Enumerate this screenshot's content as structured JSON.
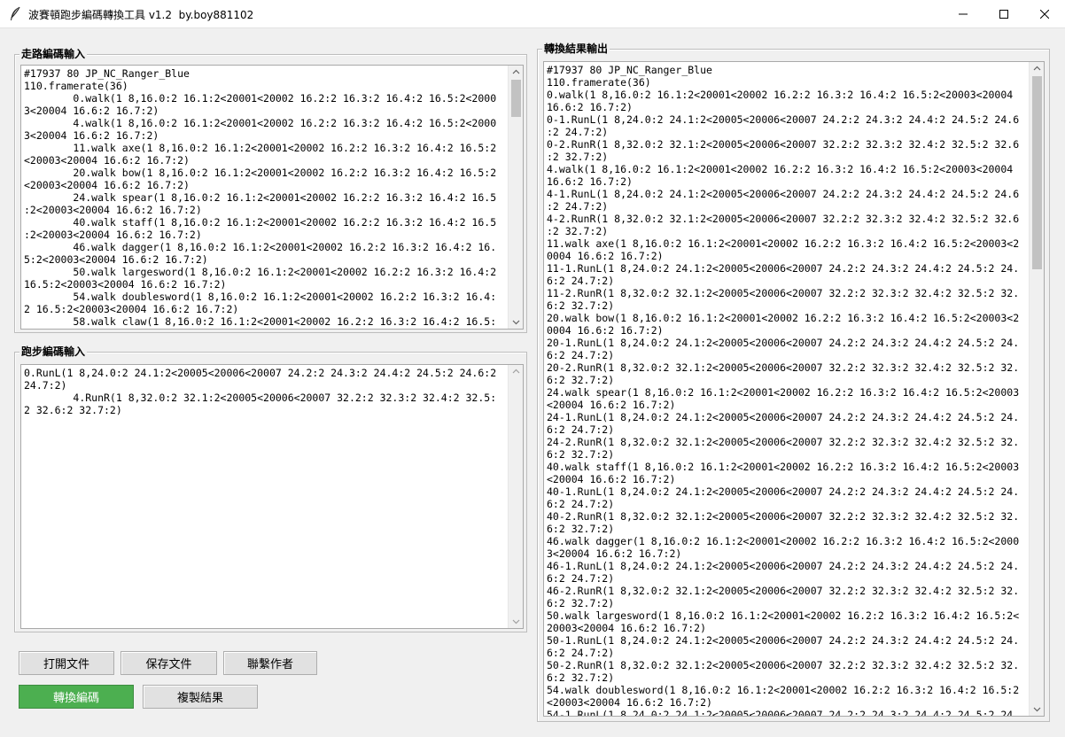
{
  "window": {
    "title": "波賽頓跑步編碼轉換工具 v1.2  by.boy881102"
  },
  "icons": {
    "app": "feather-icon",
    "minimize": "minimize-icon",
    "maximize": "maximize-icon",
    "close": "close-icon",
    "scroll_up": "chevron-up-icon",
    "scroll_down": "chevron-down-icon"
  },
  "colors": {
    "accent_button": "#4caf50",
    "background": "#f0f0f0"
  },
  "walk_input": {
    "label": "走路編碼輸入",
    "text": "#17937 80 JP_NC_Ranger_Blue\n110.framerate(36)\n\t0.walk(1 8,16.0:2 16.1:2<20001<20002 16.2:2 16.3:2 16.4:2 16.5:2<2000\n3<20004 16.6:2 16.7:2)\n\t4.walk(1 8,16.0:2 16.1:2<20001<20002 16.2:2 16.3:2 16.4:2 16.5:2<2000\n3<20004 16.6:2 16.7:2)\n\t11.walk axe(1 8,16.0:2 16.1:2<20001<20002 16.2:2 16.3:2 16.4:2 16.5:2\n<20003<20004 16.6:2 16.7:2)\n\t20.walk bow(1 8,16.0:2 16.1:2<20001<20002 16.2:2 16.3:2 16.4:2 16.5:2\n<20003<20004 16.6:2 16.7:2)\n\t24.walk spear(1 8,16.0:2 16.1:2<20001<20002 16.2:2 16.3:2 16.4:2 16.5\n:2<20003<20004 16.6:2 16.7:2)\n\t40.walk staff(1 8,16.0:2 16.1:2<20001<20002 16.2:2 16.3:2 16.4:2 16.5\n:2<20003<20004 16.6:2 16.7:2)\n\t46.walk dagger(1 8,16.0:2 16.1:2<20001<20002 16.2:2 16.3:2 16.4:2 16.\n5:2<20003<20004 16.6:2 16.7:2)\n\t50.walk largesword(1 8,16.0:2 16.1:2<20001<20002 16.2:2 16.3:2 16.4:2\n16.5:2<20003<20004 16.6:2 16.7:2)\n\t54.walk doublesword(1 8,16.0:2 16.1:2<20001<20002 16.2:2 16.3:2 16.4:\n2 16.5:2<20003<20004 16.6:2 16.7:2)\n\t58.walk claw(1 8,16.0:2 16.1:2<20001<20002 16.2:2 16.3:2 16.4:2 16.5:"
  },
  "run_input": {
    "label": "跑步編碼輸入",
    "text": "0.RunL(1 8,24.0:2 24.1:2<20005<20006<20007 24.2:2 24.3:2 24.4:2 24.5:2 24.6:2\n24.7:2)\n\t4.RunR(1 8,32.0:2 32.1:2<20005<20006<20007 32.2:2 32.3:2 32.4:2 32.5:\n2 32.6:2 32.7:2)"
  },
  "output": {
    "label": "轉換結果輸出",
    "text": "#17937 80 JP_NC_Ranger_Blue\n110.framerate(36)\n0.walk(1 8,16.0:2 16.1:2<20001<20002 16.2:2 16.3:2 16.4:2 16.5:2<20003<20004\n16.6:2 16.7:2)\n0-1.RunL(1 8,24.0:2 24.1:2<20005<20006<20007 24.2:2 24.3:2 24.4:2 24.5:2 24.6\n:2 24.7:2)\n0-2.RunR(1 8,32.0:2 32.1:2<20005<20006<20007 32.2:2 32.3:2 32.4:2 32.5:2 32.6\n:2 32.7:2)\n4.walk(1 8,16.0:2 16.1:2<20001<20002 16.2:2 16.3:2 16.4:2 16.5:2<20003<20004\n16.6:2 16.7:2)\n4-1.RunL(1 8,24.0:2 24.1:2<20005<20006<20007 24.2:2 24.3:2 24.4:2 24.5:2 24.6\n:2 24.7:2)\n4-2.RunR(1 8,32.0:2 32.1:2<20005<20006<20007 32.2:2 32.3:2 32.4:2 32.5:2 32.6\n:2 32.7:2)\n11.walk axe(1 8,16.0:2 16.1:2<20001<20002 16.2:2 16.3:2 16.4:2 16.5:2<20003<2\n0004 16.6:2 16.7:2)\n11-1.RunL(1 8,24.0:2 24.1:2<20005<20006<20007 24.2:2 24.3:2 24.4:2 24.5:2 24.\n6:2 24.7:2)\n11-2.RunR(1 8,32.0:2 32.1:2<20005<20006<20007 32.2:2 32.3:2 32.4:2 32.5:2 32.\n6:2 32.7:2)\n20.walk bow(1 8,16.0:2 16.1:2<20001<20002 16.2:2 16.3:2 16.4:2 16.5:2<20003<2\n0004 16.6:2 16.7:2)\n20-1.RunL(1 8,24.0:2 24.1:2<20005<20006<20007 24.2:2 24.3:2 24.4:2 24.5:2 24.\n6:2 24.7:2)\n20-2.RunR(1 8,32.0:2 32.1:2<20005<20006<20007 32.2:2 32.3:2 32.4:2 32.5:2 32.\n6:2 32.7:2)\n24.walk spear(1 8,16.0:2 16.1:2<20001<20002 16.2:2 16.3:2 16.4:2 16.5:2<20003\n<20004 16.6:2 16.7:2)\n24-1.RunL(1 8,24.0:2 24.1:2<20005<20006<20007 24.2:2 24.3:2 24.4:2 24.5:2 24.\n6:2 24.7:2)\n24-2.RunR(1 8,32.0:2 32.1:2<20005<20006<20007 32.2:2 32.3:2 32.4:2 32.5:2 32.\n6:2 32.7:2)\n40.walk staff(1 8,16.0:2 16.1:2<20001<20002 16.2:2 16.3:2 16.4:2 16.5:2<20003\n<20004 16.6:2 16.7:2)\n40-1.RunL(1 8,24.0:2 24.1:2<20005<20006<20007 24.2:2 24.3:2 24.4:2 24.5:2 24.\n6:2 24.7:2)\n40-2.RunR(1 8,32.0:2 32.1:2<20005<20006<20007 32.2:2 32.3:2 32.4:2 32.5:2 32.\n6:2 32.7:2)\n46.walk dagger(1 8,16.0:2 16.1:2<20001<20002 16.2:2 16.3:2 16.4:2 16.5:2<2000\n3<20004 16.6:2 16.7:2)\n46-1.RunL(1 8,24.0:2 24.1:2<20005<20006<20007 24.2:2 24.3:2 24.4:2 24.5:2 24.\n6:2 24.7:2)\n46-2.RunR(1 8,32.0:2 32.1:2<20005<20006<20007 32.2:2 32.3:2 32.4:2 32.5:2 32.\n6:2 32.7:2)\n50.walk largesword(1 8,16.0:2 16.1:2<20001<20002 16.2:2 16.3:2 16.4:2 16.5:2<\n20003<20004 16.6:2 16.7:2)\n50-1.RunL(1 8,24.0:2 24.1:2<20005<20006<20007 24.2:2 24.3:2 24.4:2 24.5:2 24.\n6:2 24.7:2)\n50-2.RunR(1 8,32.0:2 32.1:2<20005<20006<20007 32.2:2 32.3:2 32.4:2 32.5:2 32.\n6:2 32.7:2)\n54.walk doublesword(1 8,16.0:2 16.1:2<20001<20002 16.2:2 16.3:2 16.4:2 16.5:2\n<20003<20004 16.6:2 16.7:2)\n54-1.RunL(1 8,24.0:2 24.1:2<20005<20006<20007 24.2:2 24.3:2 24.4:2 24.5:2 24."
  },
  "buttons": {
    "open_file": "打開文件",
    "save_file": "保存文件",
    "contact_author": "聯繫作者",
    "convert": "轉換編碼",
    "copy_result": "複製結果"
  }
}
